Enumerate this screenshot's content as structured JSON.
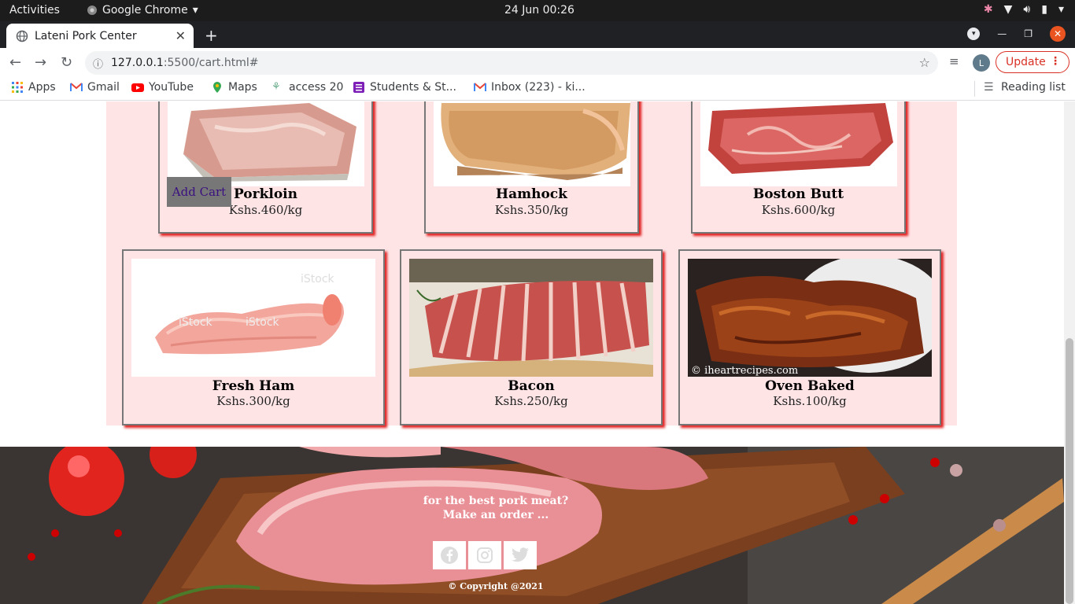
{
  "system": {
    "activities": "Activities",
    "app_name": "Google Chrome",
    "clock": "24 Jun  00:26"
  },
  "browser": {
    "tab_title": "Lateni Pork Center",
    "url_host": "127.0.0.1",
    "url_path": ":5500/cart.html#",
    "profile_initial": "L",
    "update_label": "Update"
  },
  "bookmarks": [
    {
      "label": "Apps",
      "icon": "apps-grid-icon"
    },
    {
      "label": "Gmail",
      "icon": "gmail-icon"
    },
    {
      "label": "YouTube",
      "icon": "youtube-icon"
    },
    {
      "label": "Maps",
      "icon": "maps-icon"
    },
    {
      "label": "access 20",
      "icon": "tree-icon"
    },
    {
      "label": "Students & St...",
      "icon": "forms-icon"
    },
    {
      "label": "Inbox (223) - ki...",
      "icon": "gmail-icon"
    }
  ],
  "reading_list": "Reading list",
  "add_cart_label": "Add Cart",
  "products": [
    {
      "name": "Porkloin",
      "price": "Kshs.460/kg"
    },
    {
      "name": "Hamhock",
      "price": "Kshs.350/kg"
    },
    {
      "name": "Boston Butt",
      "price": "Kshs.600/kg"
    },
    {
      "name": "Fresh Ham",
      "price": "Kshs.300/kg"
    },
    {
      "name": "Bacon",
      "price": "Kshs.250/kg"
    },
    {
      "name": "Oven Baked",
      "price": "Kshs.100/kg"
    }
  ],
  "footer": {
    "line1": "for the best pork meat?",
    "line2": "Make an order ...",
    "copyright": "© Copyright @2021",
    "social": [
      "facebook-icon",
      "instagram-icon",
      "twitter-icon"
    ]
  },
  "watermark": "© iheartrecipes.com"
}
